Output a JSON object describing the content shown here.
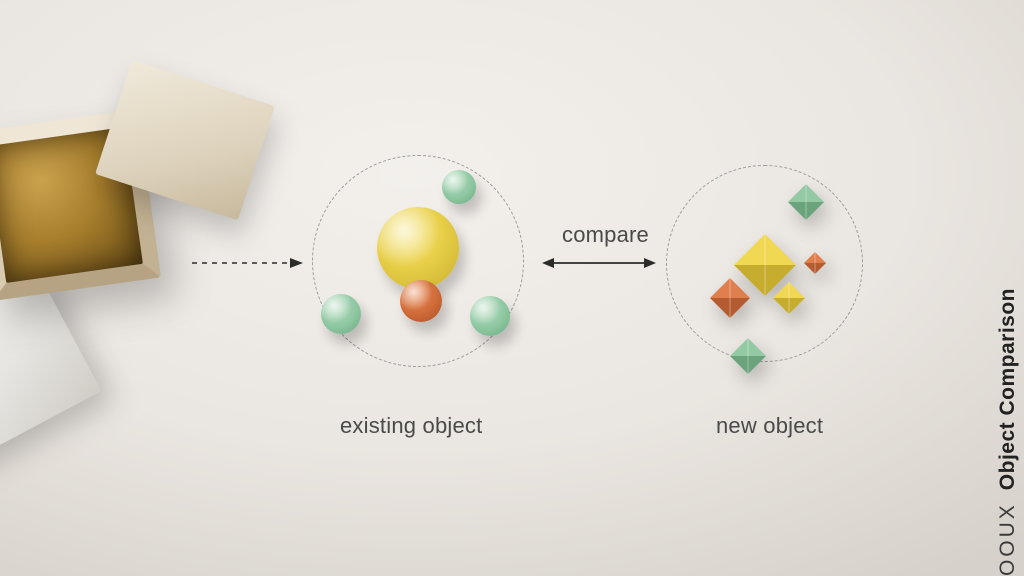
{
  "labels": {
    "compare": "compare",
    "existing": "existing object",
    "new": "new object"
  },
  "title": {
    "prefix": "OOUX",
    "main": "Object Comparison"
  },
  "clusters": {
    "existing": {
      "boundary": "dashed-circle",
      "shapes": [
        {
          "kind": "sphere",
          "color": "yellow",
          "size": "large"
        },
        {
          "kind": "sphere",
          "color": "orange",
          "size": "small"
        },
        {
          "kind": "sphere",
          "color": "green",
          "size": "small"
        },
        {
          "kind": "sphere",
          "color": "green",
          "size": "small"
        },
        {
          "kind": "sphere",
          "color": "green",
          "size": "small"
        }
      ]
    },
    "new": {
      "boundary": "dashed-circle",
      "shapes": [
        {
          "kind": "octahedron",
          "color": "yellow",
          "size": "large"
        },
        {
          "kind": "octahedron",
          "color": "yellow",
          "size": "small"
        },
        {
          "kind": "octahedron",
          "color": "orange",
          "size": "medium"
        },
        {
          "kind": "octahedron",
          "color": "orange",
          "size": "tiny"
        },
        {
          "kind": "octahedron",
          "color": "green",
          "size": "small"
        },
        {
          "kind": "octahedron",
          "color": "green",
          "size": "small"
        }
      ]
    }
  },
  "arrows": {
    "from_box": {
      "style": "dashed",
      "heads": "right"
    },
    "compare": {
      "style": "solid",
      "heads": "both"
    }
  },
  "colors": {
    "yellow": "#e8cf48",
    "orange": "#cf6a39",
    "green": "#8cc7a0",
    "ink": "#2b2b2b",
    "bg": "#ece8e2"
  }
}
